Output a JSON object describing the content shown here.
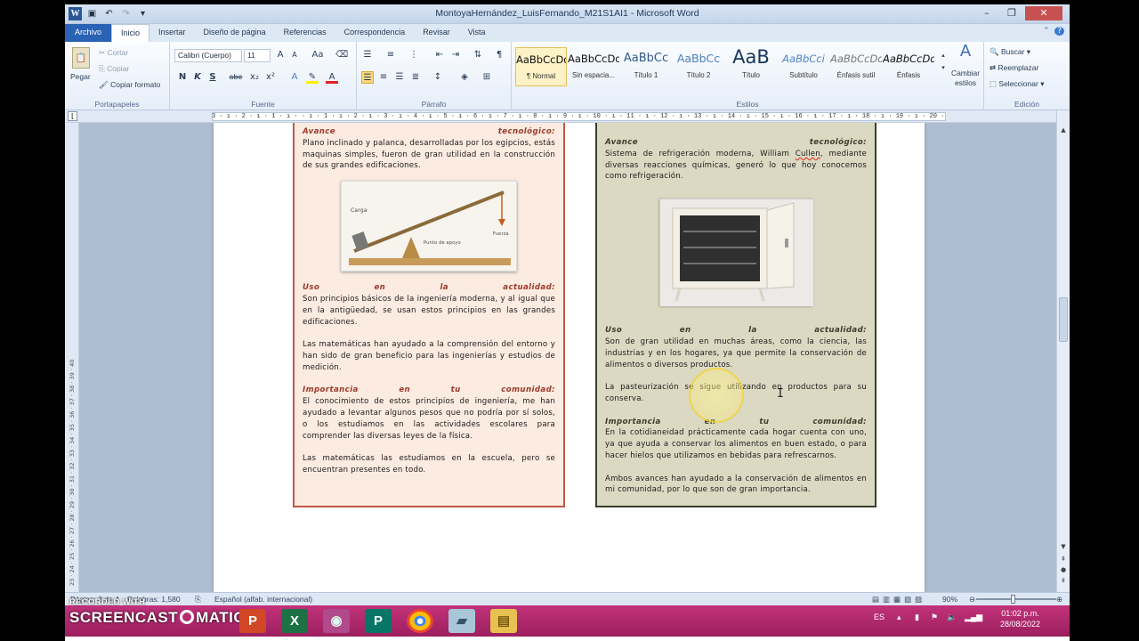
{
  "window": {
    "title": "MontoyaHernández_LuisFernando_M21S1AI1 - Microsoft Word",
    "controls": [
      "–",
      "❐",
      "✕"
    ]
  },
  "quick_access": {
    "word_icon": "W",
    "save_icon": "save-icon",
    "undo_icon": "undo-icon",
    "redo_icon": "redo-icon"
  },
  "tabs": [
    "Archivo",
    "Inicio",
    "Insertar",
    "Diseño de página",
    "Referencias",
    "Correspondencia",
    "Revisar",
    "Vista"
  ],
  "ribbon": {
    "portapapeles": {
      "title": "Portapapeles",
      "paste": "Pegar",
      "cut": "Cortar",
      "copy": "Copiar",
      "format_painter": "Copiar formato"
    },
    "fuente": {
      "title": "Fuente",
      "font_name": "Calibri (Cuerpo)",
      "font_size": "11",
      "bold": "N",
      "italic": "K",
      "underline": "S",
      "strike": "abe",
      "sub": "x₂",
      "sup": "x²",
      "grow": "A",
      "shrink": "A",
      "case": "Aa",
      "clear": "clear-format-icon"
    },
    "parrafo": {
      "title": "Párrafo",
      "pilcrow": "¶"
    },
    "estilos": {
      "title": "Estilos",
      "items": [
        {
          "preview": "AaBbCcDd",
          "name": "¶ Normal"
        },
        {
          "preview": "AaBbCcDd",
          "name": "Sin espacia..."
        },
        {
          "preview": "AaBbCc",
          "name": "Título 1"
        },
        {
          "preview": "AaBbCc",
          "name": "Título 2"
        },
        {
          "preview": "AaB",
          "name": "Título"
        },
        {
          "preview": "AaBbCci",
          "name": "Subtítulo"
        },
        {
          "preview": "AaBbCcDd",
          "name": "Énfasis sutil"
        },
        {
          "preview": "AaBbCcDd",
          "name": "Énfasis"
        }
      ],
      "change_styles": "Cambiar estilos"
    },
    "edicion": {
      "title": "Edición",
      "find": "Buscar",
      "replace": "Reemplazar",
      "select": "Seleccionar"
    }
  },
  "ruler": {
    "text": "3 · ı · 2 · ı · 1 · ı ·   · ı · 1 · ı · 2 · ı · 3 · ı · 4 · ı · 5 · ı · 6 · ı · 7 · ı · 8 · ı · 9 · ı · 10 · ı · 11 · ı · 12 · ı · 13 · ı · 14 · ı · 15 · ı · 16 · ı · 17 · ı · 18 · ı · 19 · ı · 20 · ı · 21 · ı · 22 · ı · 23 · ı · 24",
    "vtext": "23 · 24 · 25 · 26 · 27 · 28 · 29 · 30 · 31 · 32 · 33 · 34 · 35 · 36 · 37 · 38 · 39 · 40"
  },
  "card1": {
    "avance_head": [
      "Avance",
      "tecnológico:"
    ],
    "avance_text": "Plano inclinado y palanca, desarrolladas por los egipcios, estás maquinas simples, fueron de gran utilidad en la construcción de sus grandes edificaciones.",
    "uso_head": [
      "Uso",
      "en",
      "la",
      "actualidad:"
    ],
    "uso_text1": "Son principios básicos de la ingeniería moderna, y al igual que en la antigüedad, se usan estos principios en las grandes edificaciones.",
    "uso_text2": "Las matemáticas han ayudado a la comprensión del entorno y han sido de gran beneficio para las ingenierías y estudios de medición.",
    "imp_head": [
      "Importancia",
      "en",
      "tu",
      "comunidad:"
    ],
    "imp_text1": "El conocimiento de estos principios de ingeniería, me han ayudado a levantar algunos pesos que no podría por sí solos, o los estudiamos en las actividades escolares para comprender las diversas leyes de la física.",
    "imp_text2": "Las matemáticas las estudiamos en la escuela, pero se encuentran presentes en todo.",
    "image_labels": {
      "carga": "Carga",
      "fuerza": "Fuerza",
      "punto": "Punto de apoyo"
    }
  },
  "card2": {
    "avance_head": [
      "Avance",
      "tecnológico:"
    ],
    "avance_text_pre": "Sistema de refrigeración moderna, William ",
    "avance_text_spell": "Cullen",
    "avance_text_post": ", mediante diversas reacciones químicas, generó lo que hoy conocemos como refrigeración.",
    "uso_head": [
      "Uso",
      "en",
      "la",
      "actualidad:"
    ],
    "uso_text1": "Son de gran utilidad en muchas áreas, como la ciencia, las industrias y en los hogares, ya que permite la conservación de alimentos o diversos productos.",
    "uso_text2": "La pasteurización se sigue utilizando en productos para su conserva.",
    "imp_head": [
      "Importancia",
      "en",
      "tu",
      "comunidad:"
    ],
    "imp_text1": "En la cotidianeidad prácticamente cada hogar cuenta con uno, ya que ayuda a conservar los alimentos en buen estado, o para hacer hielos que utilizamos en bebidas para refrescarnos.",
    "imp_text2": "Ambos avances han ayudado a la conservación de alimentos en mi comunidad, por lo que son de gran importancia."
  },
  "status": {
    "page": "Página: 3 de 4",
    "words": "Palabras: 1,580",
    "language": "Español (alfab. internacional)",
    "zoom": "90%"
  },
  "taskbar": {
    "recorded": "RECORDED WITH",
    "screencast": "SCREENCAST",
    "matic": "MATIC",
    "lang": "ES",
    "time": "01:02 p.m.",
    "date": "28/08/2022",
    "apps": [
      "P",
      "X",
      "◉",
      "P",
      "●",
      "▰",
      "▤"
    ]
  }
}
